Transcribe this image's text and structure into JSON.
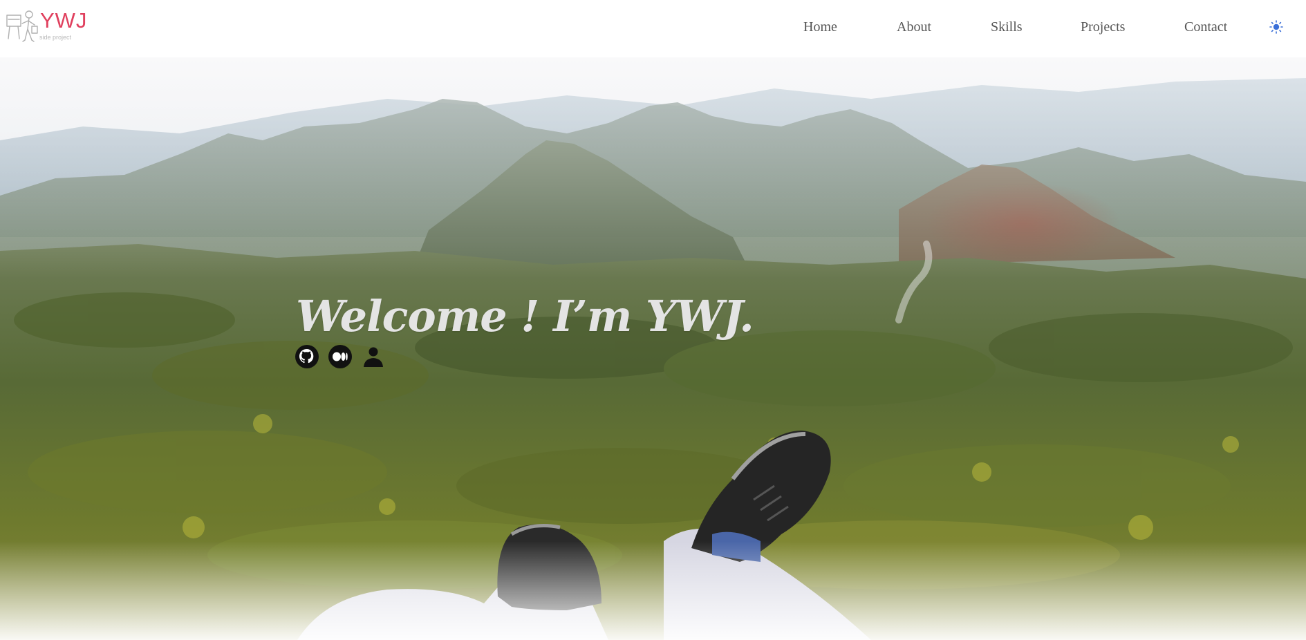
{
  "header": {
    "logo": {
      "title": "YWJ",
      "subtitle": "side project"
    },
    "nav": [
      {
        "label": "Home"
      },
      {
        "label": "About"
      },
      {
        "label": "Skills"
      },
      {
        "label": "Projects"
      },
      {
        "label": "Contact"
      }
    ],
    "theme_toggle_icon": "sun-icon"
  },
  "hero": {
    "welcome_text": "Welcome ! I’m YWJ.",
    "socials": [
      {
        "icon": "github-icon"
      },
      {
        "icon": "medium-icon"
      },
      {
        "icon": "person-icon"
      }
    ]
  },
  "colors": {
    "brand": "#e0405e",
    "nav_text": "#555555",
    "toggle": "#3a6fd8"
  }
}
